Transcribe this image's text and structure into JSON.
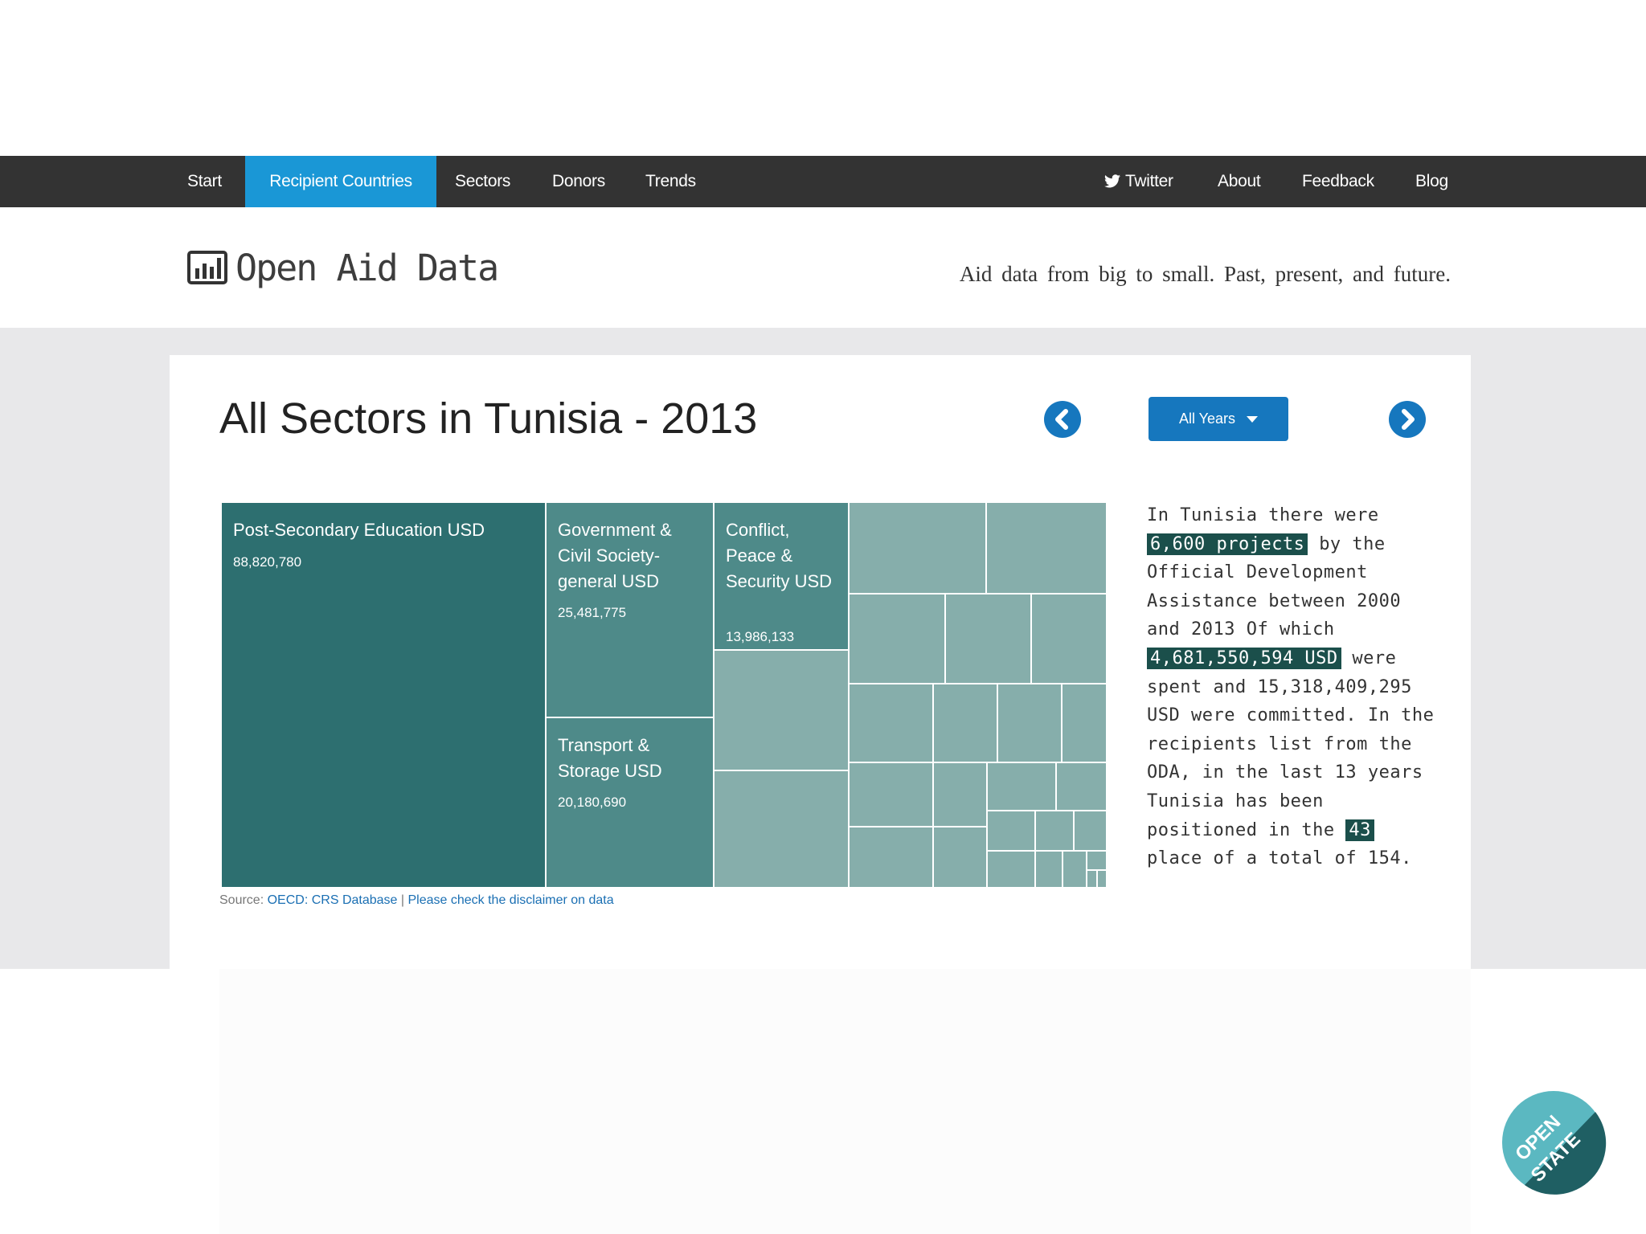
{
  "nav": {
    "left": [
      "Start",
      "Recipient Countries",
      "Sectors",
      "Donors",
      "Trends"
    ],
    "active": "Recipient Countries",
    "right": [
      "Twitter",
      "About",
      "Feedback",
      "Blog"
    ]
  },
  "header": {
    "logo_text": "Open Aid Data",
    "tagline": "Aid data from big to small. Past, present, and future."
  },
  "page": {
    "title": "All Sectors in Tunisia - 2013",
    "year_dropdown": "All Years",
    "prev_icon": "chevron-left-circle",
    "next_icon": "chevron-right-circle"
  },
  "treemap": {
    "labeled": [
      {
        "label": "Post-Secondary Education USD",
        "value": "88,820,780"
      },
      {
        "label": "Government & Civil Society-general USD",
        "value": "25,481,775"
      },
      {
        "label": "Transport & Storage USD",
        "value": "20,180,690"
      },
      {
        "label": "Conflict, Peace & Security USD",
        "value": "13,986,133"
      }
    ],
    "colors": {
      "dark": "#2d6f70",
      "mid": "#4e8a89",
      "light": "#86aeab"
    }
  },
  "source": {
    "prefix": "Source:",
    "link1": "OECD: CRS Database",
    "separator": "|",
    "link2": "Please check the disclaimer on data"
  },
  "summary": {
    "t1": "In Tunisia there were",
    "hl1": "6,600 projects",
    "t2": "by the Official Development Assistance between 2000 and 2013 Of which",
    "hl2": "4,681,550,594 USD",
    "t3": "were spent and 15,318,409,295 USD were committed. In the recipients list from the ODA, in the last 13 years Tunisia has been positioned in the",
    "hl3": "43",
    "t4": "place of a total of 154."
  },
  "badge": {
    "line1": "OPEN",
    "line2": "STATE",
    "color": "#1f5f63",
    "accent": "#5bb8c1"
  }
}
